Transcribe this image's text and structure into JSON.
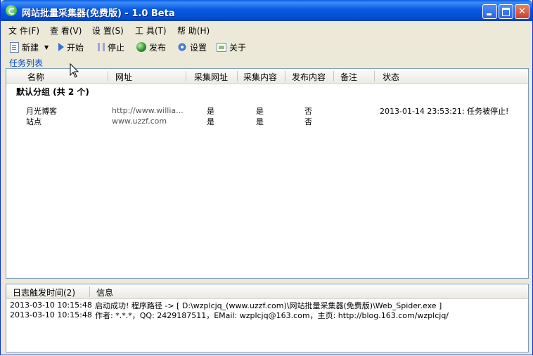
{
  "window": {
    "title": "网站批量采集器(免费版) - 1.0 Beta"
  },
  "menu": [
    "文 件(F)",
    "查 看(V)",
    "设 置(S)",
    "工 具(T)",
    "帮 助(H)"
  ],
  "toolbar": {
    "new": "新建",
    "start": "开始",
    "stop": "停止",
    "publish": "发布",
    "settings": "设置",
    "about": "关于"
  },
  "tasklist": {
    "label": "任务列表",
    "columns": [
      "名称",
      "网址",
      "采集网址",
      "采集内容",
      "发布内容",
      "备注",
      "状态"
    ],
    "group": "默认分组 (共 2 个)",
    "rows": [
      {
        "name": "月光博客",
        "url": "http://www.willia...",
        "collect_url": "是",
        "collect_content": "是",
        "publish": "否",
        "note": "",
        "status": "2013-01-14 23:53:21: 任务被停止!"
      },
      {
        "name": "站点",
        "url": "www.uzzf.com",
        "collect_url": "是",
        "collect_content": "是",
        "publish": "否",
        "note": "",
        "status": ""
      }
    ]
  },
  "log": {
    "col_time": "日志触发时间(2)",
    "col_info": "信息",
    "rows": [
      {
        "time": "2013-03-10 10:15:48",
        "info": "启动成功! 程序路径 -> [ D:\\wzplcjq_(www.uzzf.com)\\网站批量采集器(免费版)\\Web_Spider.exe ]"
      },
      {
        "time": "2013-03-10 10:15:48",
        "info": "作者: *.*.*，QQ: 2429187511，EMail: wzplcjq@163.com，主页: http://blog.163.com/wzplcjq/"
      }
    ]
  }
}
